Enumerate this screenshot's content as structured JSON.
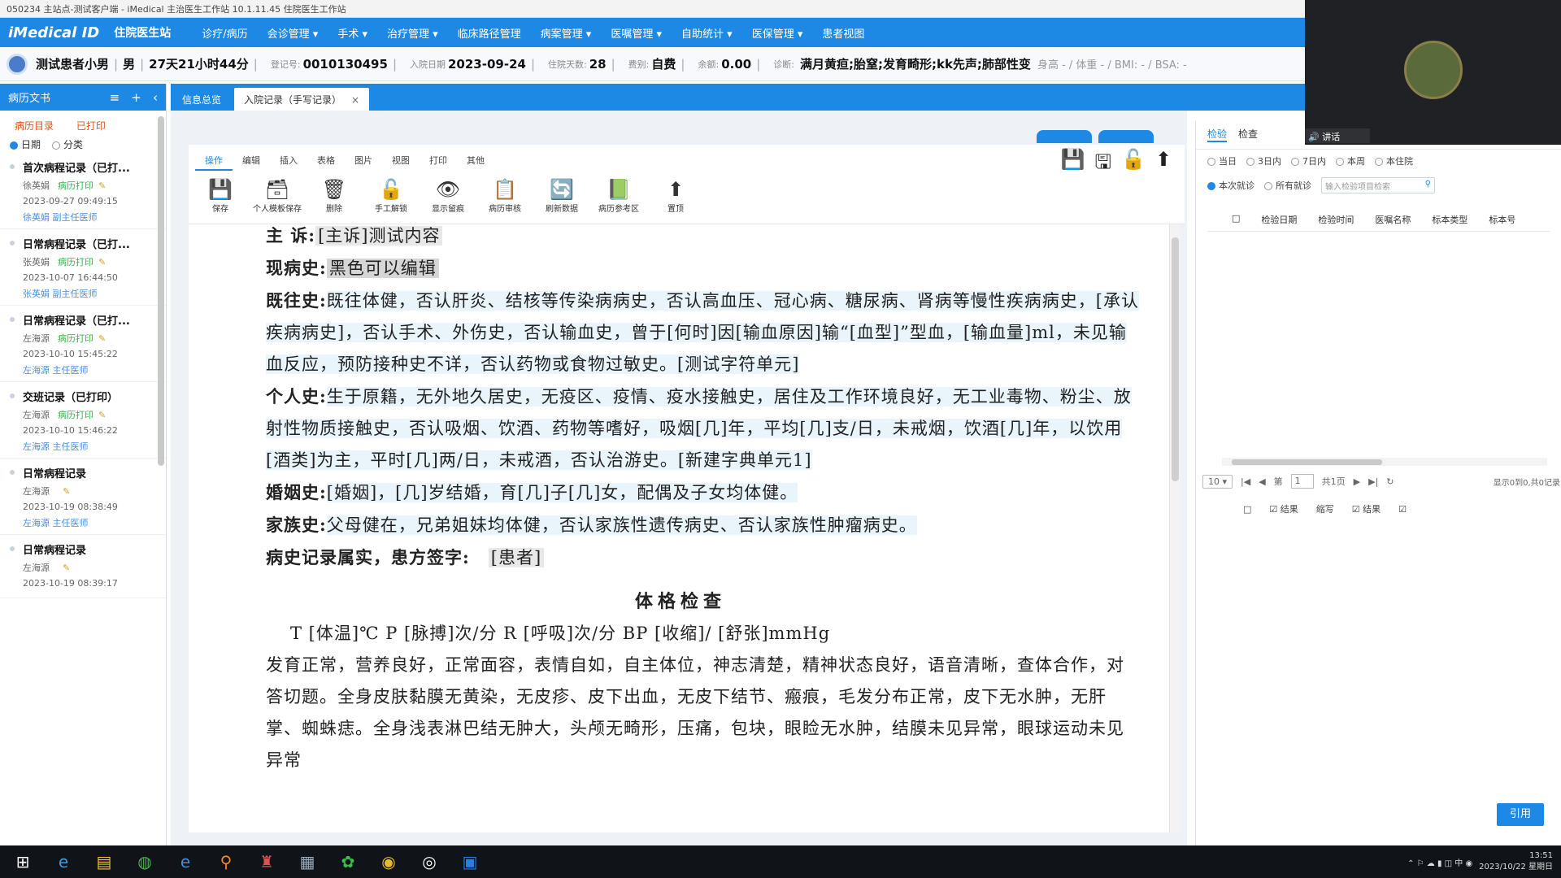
{
  "titlebar": {
    "text": "050234 主站点-测试客户端 - iMedical 主治医生工作站 10.1.11.45 住院医生工作站"
  },
  "menu": {
    "logo": "iMedical ID",
    "workstation": "住院医生站",
    "items": [
      "诊疗/病历",
      "会诊管理 ▾",
      "手术 ▾",
      "治疗管理 ▾",
      "临床路径管理",
      "病案管理 ▾",
      "医嘱管理 ▾",
      "自助统计 ▾",
      "医保管理 ▾",
      "患者视图"
    ]
  },
  "patient": {
    "name": "测试患者小男",
    "sex": "男",
    "age": "27天21小时44分",
    "reg_label": "登记号:",
    "reg_no": "0010130495",
    "admit_label": "入院日期",
    "admit_date": "2023-09-24",
    "days_label": "住院天数:",
    "days": "28",
    "fee_label": "费别:",
    "fee_type": "自费",
    "balance_label": "余额:",
    "balance": "0.00",
    "diag_label": "诊断:",
    "diagnosis": "满月黄疸;胎窒;发育畸形;kk先声;肺部性变",
    "extra": "身高 - / 体重 - / BMI: - / BSA: -"
  },
  "left": {
    "header": "病历文书",
    "header_icons": [
      "≡",
      "+",
      "‹"
    ],
    "tabs": [
      "病历目录",
      "已打印"
    ],
    "radios": [
      {
        "label": "日期",
        "on": true
      },
      {
        "label": "分类",
        "on": false
      }
    ],
    "records": [
      {
        "title": "首次病程记录（已打...",
        "doctor": "徐英娟",
        "status": "病历打印",
        "date": "2023-09-27 09:49:15",
        "extra": "徐英娟  副主任医师"
      },
      {
        "title": "日常病程记录（已打...",
        "doctor": "张英娟",
        "status": "病历打印",
        "date": "2023-10-07 16:44:50",
        "extra": "张英娟  副主任医师"
      },
      {
        "title": "日常病程记录（已打...",
        "doctor": "左海源",
        "status": "病历打印",
        "date": "2023-10-10 15:45:22",
        "extra": "左海源  主任医师"
      },
      {
        "title": "交班记录（已打印）",
        "doctor": "左海源",
        "status": "病历打印",
        "date": "2023-10-10 15:46:22",
        "extra": "左海源  主任医师"
      },
      {
        "title": "日常病程记录",
        "doctor": "左海源",
        "status": "",
        "date": "2023-10-19 08:38:49",
        "extra": "左海源  主任医师"
      },
      {
        "title": "日常病程记录",
        "doctor": "左海源",
        "status": "",
        "date": "2023-10-19 08:39:17",
        "extra": ""
      }
    ]
  },
  "doctabs": [
    {
      "label": "信息总览",
      "active": false
    },
    {
      "label": "入院记录（手写记录）",
      "active": true,
      "close": "×"
    }
  ],
  "toolbar": {
    "tabs": [
      "操作",
      "编辑",
      "插入",
      "表格",
      "图片",
      "视图",
      "打印",
      "其他"
    ],
    "buttons": [
      {
        "icon": "💾",
        "label": "保存"
      },
      {
        "icon": "🗃",
        "label": "个人模板保存"
      },
      {
        "icon": "🗑",
        "label": "删除"
      },
      {
        "icon": "🔓",
        "label": "手工解锁"
      },
      {
        "icon": "👁",
        "label": "显示留痕"
      },
      {
        "icon": "📋",
        "label": "病历审核"
      },
      {
        "icon": "🔄",
        "label": "刷新数据"
      },
      {
        "icon": "📗",
        "label": "病历参考区"
      },
      {
        "icon": "⬆",
        "label": "置顶"
      }
    ],
    "right_icons": [
      "💾",
      "🖫",
      "🔓",
      "⬆"
    ]
  },
  "document": {
    "chief_label": "主  诉:",
    "chief": "[主诉]测试内容",
    "present_label": "现病史:",
    "present": "黑色可以编辑",
    "past_label": "既往史:",
    "past": "既往体健，否认肝炎、结核等传染病病史，否认高血压、冠心病、糖尿病、肾病等慢性疾病病史，[承认疾病病史]，否认手术、外伤史，否认输血史，曾于[何时]因[输血原因]输“[血型]”型血，[输血量]ml，未见输血反应，预防接种史不详，否认药物或食物过敏史。[测试字符单元]",
    "personal_label": "个人史:",
    "personal": "生于原籍，无外地久居史，无疫区、疫情、疫水接触史，居住及工作环境良好，无工业毒物、粉尘、放射性物质接触史，否认吸烟、饮酒、药物等嗜好，吸烟[几]年，平均[几]支/日，未戒烟，饮酒[几]年，以饮用[酒类]为主，平时[几]两/日，未戒酒，否认治游史。[新建字典单元1]",
    "marital_label": "婚姻史:",
    "marital": "[婚姻]，[几]岁结婚，育[几]子[几]女，配偶及子女均体健。",
    "family_label": "家族史:",
    "family": "父母健在，兄弟姐妹均体健，否认家族性遗传病史、否认家族性肿瘤病史。",
    "confirm_label": "病史记录属实，患方签字:",
    "confirm_field": "[患者]",
    "exam_title": "体格检查",
    "vitals": "T [体温]℃   P [脉搏]次/分   R [呼吸]次/分   BP [收缩]/ [舒张]mmHg",
    "exam": "发育正常，营养良好，正常面容，表情自如，自主体位，神志清楚，精神状态良好，语音清晰，查体合作，对答切题。全身皮肤黏膜无黄染，无皮疹、皮下出血，无皮下结节、瘢痕，毛发分布正常，皮下无水肿，无肝掌、蜘蛛痣。全身浅表淋巴结无肿大，头颅无畸形，压痛，包块，眼睑无水肿，结膜未见异常，眼球运动未见异常"
  },
  "right": {
    "tabs": [
      "检验",
      "检查"
    ],
    "time_radios": [
      "当日",
      "3日内",
      "7日内",
      "本周",
      "本住院"
    ],
    "scope_radios": [
      "本次就诊",
      "所有就诊"
    ],
    "search_placeholder": "输入检验项目检索",
    "columns": [
      "□",
      "检验日期",
      "检验时间",
      "医嘱名称",
      "标本类型",
      "标本号"
    ],
    "pager": {
      "size": "10 ▾",
      "first": "|◀",
      "prev": "◀",
      "page_label": "第",
      "page": "1",
      "total": "共1页",
      "next": "▶",
      "last": "▶|",
      "refresh": "↻",
      "info": "显示0到0,共0记录"
    },
    "checks": [
      "□",
      "☑ 结果",
      "缩写",
      "☑ 结果",
      "☑"
    ],
    "apply": "引用"
  },
  "cam": {
    "tag": "🔊 讲话"
  },
  "taskbar": {
    "icons": [
      "⊞",
      "e",
      "▤",
      "◍",
      "e",
      "⚲",
      "♜",
      "▦",
      "✿",
      "◉",
      "◎",
      "▣"
    ],
    "time": "13:51",
    "date": "2023/10/22 星期日"
  }
}
